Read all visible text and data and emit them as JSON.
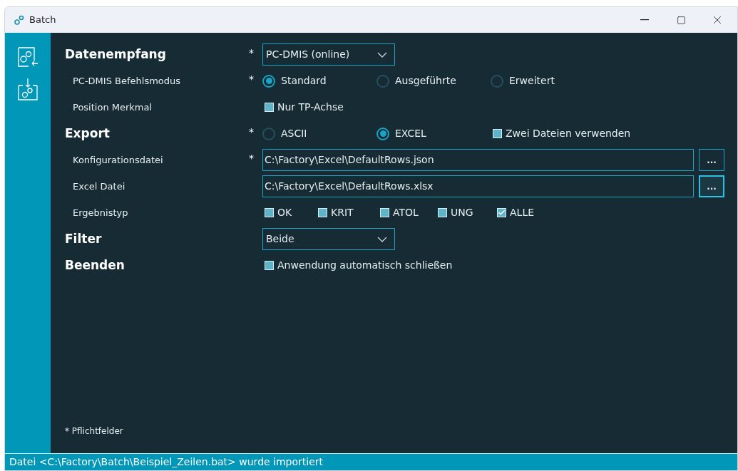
{
  "window": {
    "title": "Batch"
  },
  "rows": [
    {
      "label": "Datenempfang",
      "heading": true,
      "required": true,
      "control": {
        "kind": "dropdown",
        "value": "PC-DMIS (online)"
      }
    },
    {
      "label": "PC-DMIS Befehlsmodus",
      "heading": false,
      "required": true,
      "control": {
        "kind": "options",
        "items": [
          {
            "kind": "radio",
            "label": "Standard",
            "selected": true
          },
          {
            "kind": "radio",
            "label": "Ausgeführte",
            "selected": false
          },
          {
            "kind": "radio",
            "label": "Erweitert",
            "selected": false
          }
        ]
      }
    },
    {
      "label": "Position Merkmal",
      "heading": false,
      "required": false,
      "control": {
        "kind": "options",
        "items": [
          {
            "kind": "checkbox",
            "label": "Nur TP-Achse",
            "checked": false
          }
        ]
      }
    },
    {
      "label": "Export",
      "heading": true,
      "required": true,
      "control": {
        "kind": "options",
        "items": [
          {
            "kind": "radio",
            "label": "ASCII",
            "selected": false
          },
          {
            "kind": "radio",
            "label": "EXCEL",
            "selected": true
          },
          {
            "kind": "checkbox",
            "label": "Zwei Dateien verwenden",
            "checked": false
          }
        ]
      }
    },
    {
      "label": "Konfigurationsdatei",
      "heading": false,
      "required": true,
      "control": {
        "kind": "path",
        "value": "C:\\Factory\\Excel\\DefaultRows.json",
        "button": "...",
        "focused": false
      }
    },
    {
      "label": "Excel Datei",
      "heading": false,
      "required": false,
      "control": {
        "kind": "path",
        "value": "C:\\Factory\\Excel\\DefaultRows.xlsx",
        "button": "...",
        "focused": true
      }
    },
    {
      "label": "Ergebnistyp",
      "heading": false,
      "required": false,
      "control": {
        "kind": "checks",
        "items": [
          {
            "label": "OK",
            "checked": false
          },
          {
            "label": "KRIT",
            "checked": false
          },
          {
            "label": "ATOL",
            "checked": false
          },
          {
            "label": "UNG",
            "checked": false
          },
          {
            "label": "ALLE",
            "checked": true
          }
        ]
      }
    },
    {
      "label": "Filter",
      "heading": true,
      "required": false,
      "control": {
        "kind": "dropdown",
        "value": "Beide"
      }
    },
    {
      "label": "Beenden",
      "heading": true,
      "required": false,
      "control": {
        "kind": "options",
        "items": [
          {
            "kind": "checkbox",
            "label": "Anwendung automatisch schließen",
            "checked": false
          }
        ]
      }
    }
  ],
  "footnote": "* Pflichtfelder",
  "required_mark": "*",
  "status_bar": "Datei <C:\\Factory\\Batch\\Beispiel_Zeilen.bat> wurde importiert"
}
